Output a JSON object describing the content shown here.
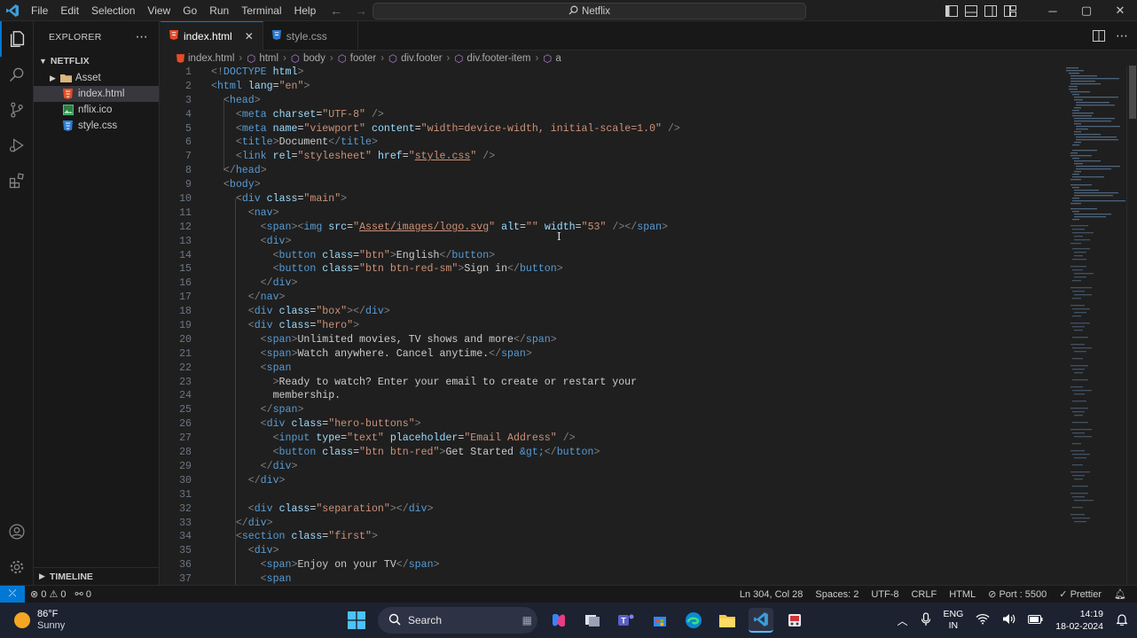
{
  "menu": [
    "File",
    "Edit",
    "Selection",
    "View",
    "Go",
    "Run",
    "Terminal",
    "Help"
  ],
  "search_title": "Netflix",
  "sidebar": {
    "title": "EXPLORER",
    "folder": "NETFLIX",
    "items": [
      {
        "label": "Asset",
        "type": "folder"
      },
      {
        "label": "index.html",
        "type": "html"
      },
      {
        "label": "nflix.ico",
        "type": "ico"
      },
      {
        "label": "style.css",
        "type": "css"
      }
    ],
    "timeline": "TIMELINE"
  },
  "tabs": [
    {
      "label": "index.html",
      "active": true
    },
    {
      "label": "style.css",
      "active": false
    }
  ],
  "breadcrumb": [
    "index.html",
    "html",
    "body",
    "footer",
    "div.footer",
    "div.footer-item",
    "a"
  ],
  "editor": {
    "lines": [
      "1",
      "2",
      "3",
      "4",
      "5",
      "6",
      "7",
      "8",
      "9",
      "10",
      "11",
      "12",
      "13",
      "14",
      "15",
      "16",
      "17",
      "18",
      "19",
      "20",
      "21",
      "22",
      "23",
      "24",
      "25",
      "26",
      "27",
      "28",
      "29",
      "30",
      "31",
      "32",
      "33",
      "34",
      "35",
      "36",
      "37"
    ]
  },
  "status": {
    "errors": "0",
    "warnings": "0",
    "ports": "0",
    "position": "Ln 304, Col 28",
    "spaces": "Spaces: 2",
    "encoding": "UTF-8",
    "eol": "CRLF",
    "language": "HTML",
    "port": "Port : 5500",
    "formatter": "Prettier"
  },
  "taskbar": {
    "temperature": "86°F",
    "weather": "Sunny",
    "search": "Search",
    "lang1": "ENG",
    "lang2": "IN",
    "time": "14:19",
    "date": "18-02-2024"
  },
  "colors": {
    "accent": "#0078d4",
    "tag": "#569cd6",
    "attr": "#9cdcfe",
    "string": "#ce9178"
  }
}
